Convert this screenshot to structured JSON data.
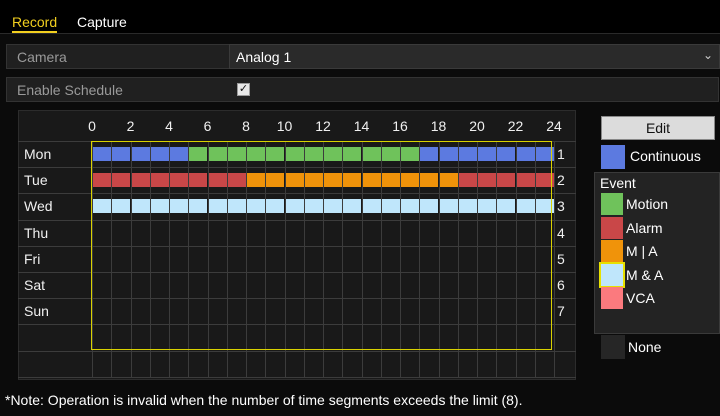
{
  "tabs": [
    {
      "label": "Record",
      "active": true
    },
    {
      "label": "Capture",
      "active": false
    }
  ],
  "camera": {
    "label": "Camera",
    "value": "Analog 1",
    "arrow_icon": "chevron-down-icon"
  },
  "enable_schedule": {
    "label": "Enable Schedule",
    "checked": true,
    "check_glyph": "✓"
  },
  "schedule": {
    "hour_labels": [
      "0",
      "2",
      "4",
      "6",
      "8",
      "10",
      "12",
      "14",
      "16",
      "18",
      "20",
      "22",
      "24"
    ],
    "days": [
      {
        "name": "Mon",
        "num": "1",
        "segments": [
          {
            "start": 0,
            "end": 5,
            "type": "Continuous"
          },
          {
            "start": 5,
            "end": 17,
            "type": "Motion"
          },
          {
            "start": 17,
            "end": 24,
            "type": "Continuous"
          }
        ]
      },
      {
        "name": "Tue",
        "num": "2",
        "segments": [
          {
            "start": 0,
            "end": 8,
            "type": "Alarm"
          },
          {
            "start": 8,
            "end": 19,
            "type": "M | A"
          },
          {
            "start": 19,
            "end": 24,
            "type": "Alarm"
          }
        ]
      },
      {
        "name": "Wed",
        "num": "3",
        "segments": [
          {
            "start": 0,
            "end": 24,
            "type": "M & A"
          }
        ]
      },
      {
        "name": "Thu",
        "num": "4",
        "segments": []
      },
      {
        "name": "Fri",
        "num": "5",
        "segments": []
      },
      {
        "name": "Sat",
        "num": "6",
        "segments": []
      },
      {
        "name": "Sun",
        "num": "7",
        "segments": []
      }
    ]
  },
  "edit_label": "Edit",
  "legend": {
    "continuous": {
      "label": "Continuous",
      "color": "#5c7ae0"
    },
    "event_heading": "Event",
    "items": [
      {
        "label": "Motion",
        "color": "#6fc25b"
      },
      {
        "label": "Alarm",
        "color": "#c94748"
      },
      {
        "label": "M | A",
        "color": "#f0930a"
      },
      {
        "label": "M & A",
        "color": "#bfe6fb"
      },
      {
        "label": "VCA",
        "color": "#fb7a7e"
      }
    ],
    "none": {
      "label": "None",
      "color": "#262626"
    }
  },
  "note": "*Note: Operation is invalid when the number of time segments exceeds the limit (8)."
}
